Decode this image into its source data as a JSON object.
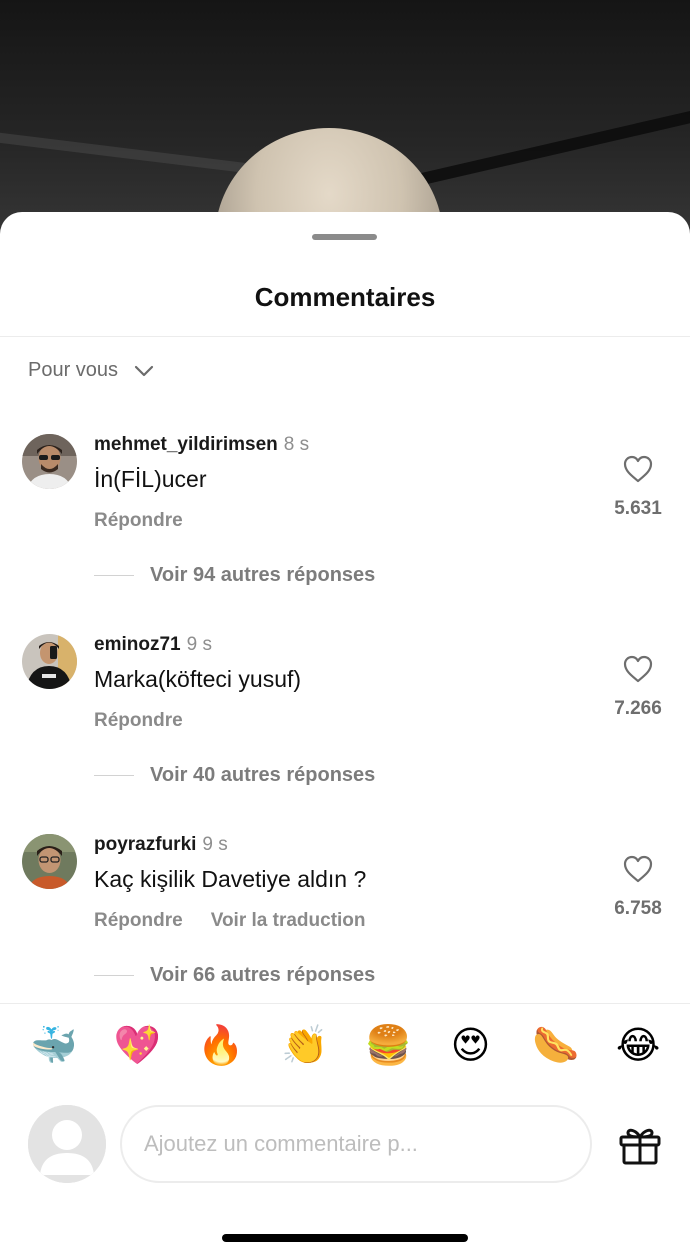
{
  "sheet": {
    "title": "Commentaires",
    "sort_label": "Pour vous"
  },
  "comments": [
    {
      "username": "mehmet_yildirimsen",
      "time": "8 s",
      "text": "İn(FİL)ucer",
      "reply_label": "Répondre",
      "replies_label": "Voir 94 autres réponses",
      "likes": "5.631"
    },
    {
      "username": "eminoz71",
      "time": "9 s",
      "text": "Marka(köfteci yusuf)",
      "reply_label": "Répondre",
      "replies_label": "Voir 40 autres réponses",
      "likes": "7.266"
    },
    {
      "username": "poyrazfurki",
      "time": "9 s",
      "text": "Kaç kişilik Davetiye aldın ?",
      "reply_label": "Répondre",
      "translate_label": "Voir la traduction",
      "replies_label": "Voir 66 autres réponses",
      "likes": "6.758"
    }
  ],
  "emoji_bar": [
    "🐳",
    "💖",
    "🔥",
    "👏",
    "🍔",
    "😍",
    "🌭",
    "😂"
  ],
  "composer": {
    "placeholder": "Ajoutez un commentaire p..."
  },
  "icons": {
    "sort": "chevron-down-icon",
    "like": "heart-outline-icon",
    "gift": "gift-icon",
    "avatar_placeholder": "default-avatar-icon"
  }
}
